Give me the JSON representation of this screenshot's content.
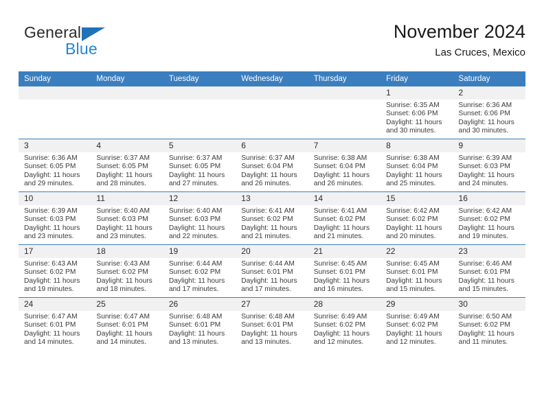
{
  "brand": {
    "name_primary": "General",
    "name_secondary": "Blue",
    "logo_icon": "triangle-logo-icon",
    "colors": {
      "primary_text": "#2b2b2b",
      "accent_blue": "#2186d6",
      "triangle_blue": "#1f72b8"
    }
  },
  "header": {
    "title": "November 2024",
    "subtitle": "Las Cruces, Mexico"
  },
  "calendar": {
    "header_background": "#3a7ebf",
    "daynum_background": "#f1f1f1",
    "weekday_headers": [
      "Sunday",
      "Monday",
      "Tuesday",
      "Wednesday",
      "Thursday",
      "Friday",
      "Saturday"
    ],
    "weeks": [
      [
        {
          "day": "",
          "sunrise": "",
          "sunset": "",
          "daylight": "",
          "daylight2": ""
        },
        {
          "day": "",
          "sunrise": "",
          "sunset": "",
          "daylight": "",
          "daylight2": ""
        },
        {
          "day": "",
          "sunrise": "",
          "sunset": "",
          "daylight": "",
          "daylight2": ""
        },
        {
          "day": "",
          "sunrise": "",
          "sunset": "",
          "daylight": "",
          "daylight2": ""
        },
        {
          "day": "",
          "sunrise": "",
          "sunset": "",
          "daylight": "",
          "daylight2": ""
        },
        {
          "day": "1",
          "sunrise": "Sunrise: 6:35 AM",
          "sunset": "Sunset: 6:06 PM",
          "daylight": "Daylight: 11 hours",
          "daylight2": "and 30 minutes."
        },
        {
          "day": "2",
          "sunrise": "Sunrise: 6:36 AM",
          "sunset": "Sunset: 6:06 PM",
          "daylight": "Daylight: 11 hours",
          "daylight2": "and 30 minutes."
        }
      ],
      [
        {
          "day": "3",
          "sunrise": "Sunrise: 6:36 AM",
          "sunset": "Sunset: 6:05 PM",
          "daylight": "Daylight: 11 hours",
          "daylight2": "and 29 minutes."
        },
        {
          "day": "4",
          "sunrise": "Sunrise: 6:37 AM",
          "sunset": "Sunset: 6:05 PM",
          "daylight": "Daylight: 11 hours",
          "daylight2": "and 28 minutes."
        },
        {
          "day": "5",
          "sunrise": "Sunrise: 6:37 AM",
          "sunset": "Sunset: 6:05 PM",
          "daylight": "Daylight: 11 hours",
          "daylight2": "and 27 minutes."
        },
        {
          "day": "6",
          "sunrise": "Sunrise: 6:37 AM",
          "sunset": "Sunset: 6:04 PM",
          "daylight": "Daylight: 11 hours",
          "daylight2": "and 26 minutes."
        },
        {
          "day": "7",
          "sunrise": "Sunrise: 6:38 AM",
          "sunset": "Sunset: 6:04 PM",
          "daylight": "Daylight: 11 hours",
          "daylight2": "and 26 minutes."
        },
        {
          "day": "8",
          "sunrise": "Sunrise: 6:38 AM",
          "sunset": "Sunset: 6:04 PM",
          "daylight": "Daylight: 11 hours",
          "daylight2": "and 25 minutes."
        },
        {
          "day": "9",
          "sunrise": "Sunrise: 6:39 AM",
          "sunset": "Sunset: 6:03 PM",
          "daylight": "Daylight: 11 hours",
          "daylight2": "and 24 minutes."
        }
      ],
      [
        {
          "day": "10",
          "sunrise": "Sunrise: 6:39 AM",
          "sunset": "Sunset: 6:03 PM",
          "daylight": "Daylight: 11 hours",
          "daylight2": "and 23 minutes."
        },
        {
          "day": "11",
          "sunrise": "Sunrise: 6:40 AM",
          "sunset": "Sunset: 6:03 PM",
          "daylight": "Daylight: 11 hours",
          "daylight2": "and 23 minutes."
        },
        {
          "day": "12",
          "sunrise": "Sunrise: 6:40 AM",
          "sunset": "Sunset: 6:03 PM",
          "daylight": "Daylight: 11 hours",
          "daylight2": "and 22 minutes."
        },
        {
          "day": "13",
          "sunrise": "Sunrise: 6:41 AM",
          "sunset": "Sunset: 6:02 PM",
          "daylight": "Daylight: 11 hours",
          "daylight2": "and 21 minutes."
        },
        {
          "day": "14",
          "sunrise": "Sunrise: 6:41 AM",
          "sunset": "Sunset: 6:02 PM",
          "daylight": "Daylight: 11 hours",
          "daylight2": "and 21 minutes."
        },
        {
          "day": "15",
          "sunrise": "Sunrise: 6:42 AM",
          "sunset": "Sunset: 6:02 PM",
          "daylight": "Daylight: 11 hours",
          "daylight2": "and 20 minutes."
        },
        {
          "day": "16",
          "sunrise": "Sunrise: 6:42 AM",
          "sunset": "Sunset: 6:02 PM",
          "daylight": "Daylight: 11 hours",
          "daylight2": "and 19 minutes."
        }
      ],
      [
        {
          "day": "17",
          "sunrise": "Sunrise: 6:43 AM",
          "sunset": "Sunset: 6:02 PM",
          "daylight": "Daylight: 11 hours",
          "daylight2": "and 19 minutes."
        },
        {
          "day": "18",
          "sunrise": "Sunrise: 6:43 AM",
          "sunset": "Sunset: 6:02 PM",
          "daylight": "Daylight: 11 hours",
          "daylight2": "and 18 minutes."
        },
        {
          "day": "19",
          "sunrise": "Sunrise: 6:44 AM",
          "sunset": "Sunset: 6:02 PM",
          "daylight": "Daylight: 11 hours",
          "daylight2": "and 17 minutes."
        },
        {
          "day": "20",
          "sunrise": "Sunrise: 6:44 AM",
          "sunset": "Sunset: 6:01 PM",
          "daylight": "Daylight: 11 hours",
          "daylight2": "and 17 minutes."
        },
        {
          "day": "21",
          "sunrise": "Sunrise: 6:45 AM",
          "sunset": "Sunset: 6:01 PM",
          "daylight": "Daylight: 11 hours",
          "daylight2": "and 16 minutes."
        },
        {
          "day": "22",
          "sunrise": "Sunrise: 6:45 AM",
          "sunset": "Sunset: 6:01 PM",
          "daylight": "Daylight: 11 hours",
          "daylight2": "and 15 minutes."
        },
        {
          "day": "23",
          "sunrise": "Sunrise: 6:46 AM",
          "sunset": "Sunset: 6:01 PM",
          "daylight": "Daylight: 11 hours",
          "daylight2": "and 15 minutes."
        }
      ],
      [
        {
          "day": "24",
          "sunrise": "Sunrise: 6:47 AM",
          "sunset": "Sunset: 6:01 PM",
          "daylight": "Daylight: 11 hours",
          "daylight2": "and 14 minutes."
        },
        {
          "day": "25",
          "sunrise": "Sunrise: 6:47 AM",
          "sunset": "Sunset: 6:01 PM",
          "daylight": "Daylight: 11 hours",
          "daylight2": "and 14 minutes."
        },
        {
          "day": "26",
          "sunrise": "Sunrise: 6:48 AM",
          "sunset": "Sunset: 6:01 PM",
          "daylight": "Daylight: 11 hours",
          "daylight2": "and 13 minutes."
        },
        {
          "day": "27",
          "sunrise": "Sunrise: 6:48 AM",
          "sunset": "Sunset: 6:01 PM",
          "daylight": "Daylight: 11 hours",
          "daylight2": "and 13 minutes."
        },
        {
          "day": "28",
          "sunrise": "Sunrise: 6:49 AM",
          "sunset": "Sunset: 6:02 PM",
          "daylight": "Daylight: 11 hours",
          "daylight2": "and 12 minutes."
        },
        {
          "day": "29",
          "sunrise": "Sunrise: 6:49 AM",
          "sunset": "Sunset: 6:02 PM",
          "daylight": "Daylight: 11 hours",
          "daylight2": "and 12 minutes."
        },
        {
          "day": "30",
          "sunrise": "Sunrise: 6:50 AM",
          "sunset": "Sunset: 6:02 PM",
          "daylight": "Daylight: 11 hours",
          "daylight2": "and 11 minutes."
        }
      ]
    ]
  }
}
